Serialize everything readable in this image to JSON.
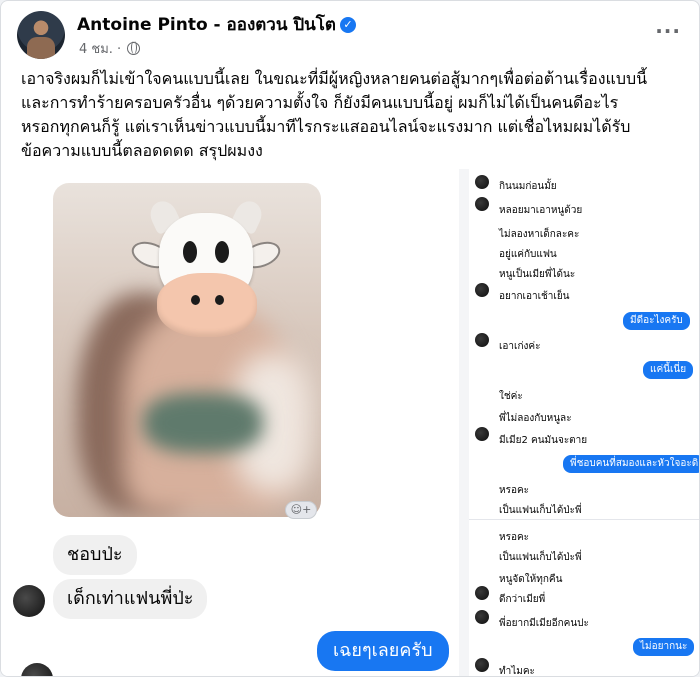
{
  "post": {
    "author": "Antoine Pinto - อองตวน ปินโต",
    "verified_icon": "verified-badge-icon",
    "time": "4 ชม. ·",
    "privacy_icon": "globe-icon",
    "more_label": "···",
    "text_lines": [
      "เอาจริงผมก็ไม่เข้าใจคนแบบนี้เลย ในขณะที่มีผู้หญิงหลายคนต่อสู้มากๆเพื่อต่อต้านเรื่องแบบนี้",
      "และการทำร้ายครอบครัวอื่น ๆด้วยความตั้งใจ  ก็ยังมีคนแบบนี้อยู่ ผมก็ไม่ได้เป็นคนดีอะไร",
      "หรอกทุกคนก็รู้ แต่เราเห็นข่าวแบบนี้มาทีไรกระแสออนไลน์จะแรงมาก แต่เชื่อไหมผมได้รับ",
      "ข้อความแบบนี้ตลอดดดด สรุปผมงง"
    ]
  },
  "chat_large": {
    "react_label": "☺+",
    "bubble1": "ชอบป่ะ",
    "bubble2": "เด็กเท่าแฟนพี่ป่ะ",
    "reply": "เฉยๆเลยครับ"
  },
  "chat_small_1": {
    "m1": "กินนมก่อนมั้ย",
    "m2": "หลอยมาเอาหนูด้วย",
    "m3": "ไม่ลองหาเด็กละคะ",
    "m4": "อยู่แค่กับแฟน",
    "m5": "หนูเป็นเมียพี่ได้นะ",
    "m6": "อยากเอาเช้าเย็น",
    "r1": "มีดีอะไงครับ",
    "m7": "เอาเก่งค่ะ",
    "r2": "แค่นี้เนี่ย",
    "m8": "ใช่ค่ะ",
    "m9": "พี่ไม่ลองกับหนูละ",
    "m10": "มีเมีย2 คนมันจะตาย",
    "r3": "พี่ชอบคนที่สมองและหัวใจอะดิ",
    "m11": "หรอคะ",
    "m12": "เป็นแฟนเก็บได้ป่ะพี่"
  },
  "chat_small_2": {
    "m1": "หรอคะ",
    "m2": "เป็นแฟนเก็บได้ป่ะพี่",
    "m3": "หนูจัดให้ทุกคืน",
    "m4": "ดีกว่าเมียพี่",
    "m5": "พี่อยากมีเมียอีกคนปะ",
    "r1": "ไม่อยากนะ",
    "m6": "ทำไมคะ"
  }
}
